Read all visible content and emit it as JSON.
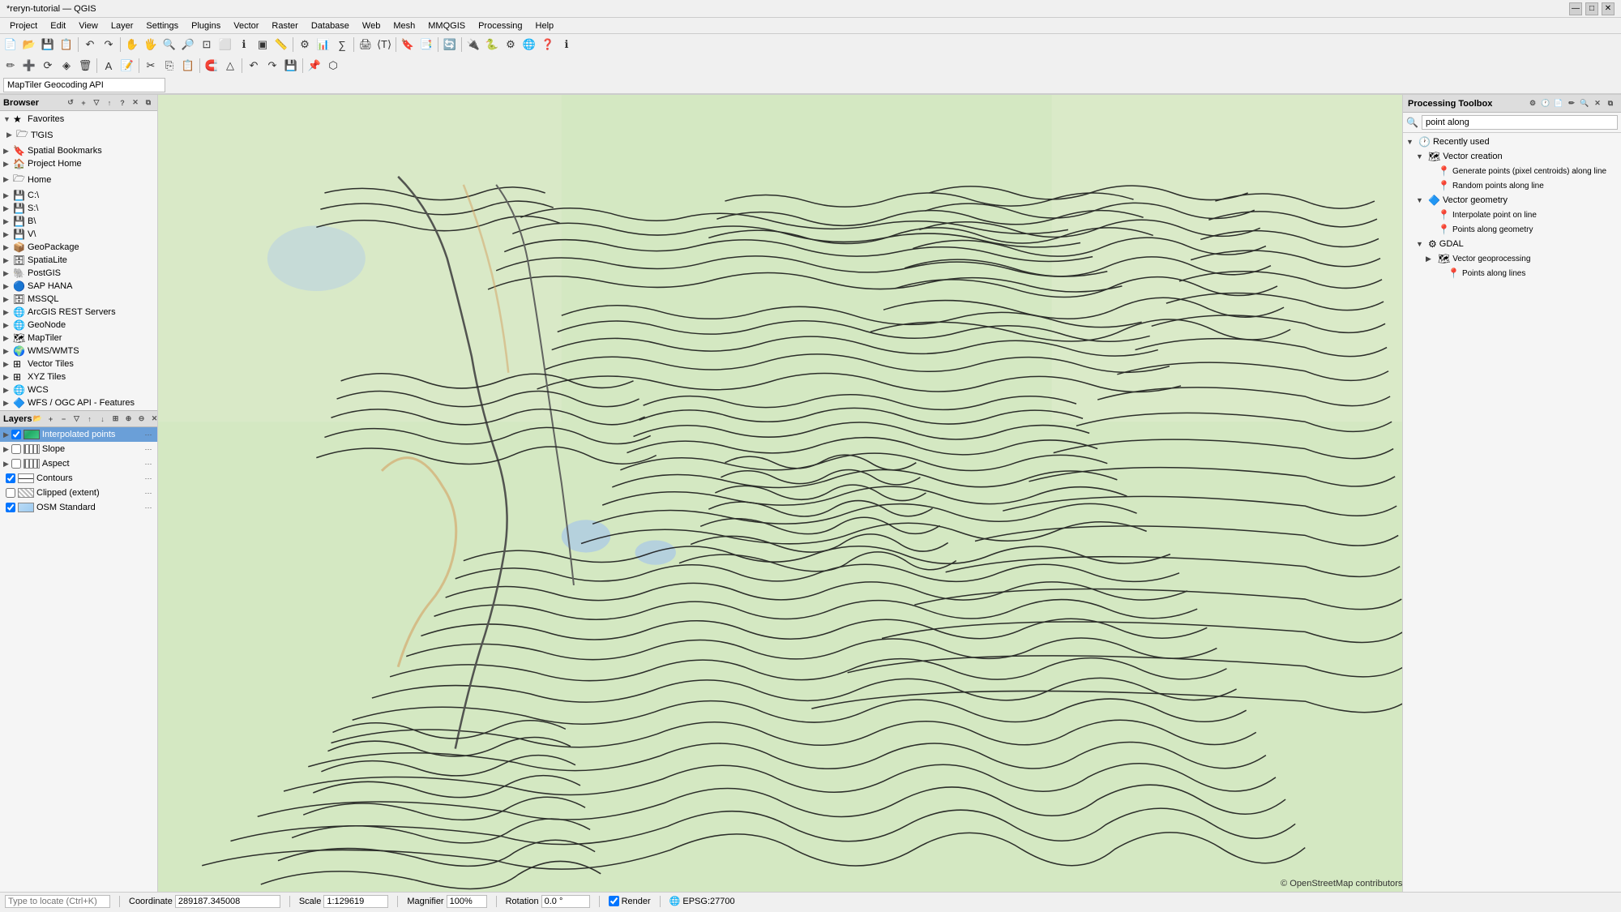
{
  "titlebar": {
    "title": "*reryn-tutorial — QGIS",
    "controls": [
      "—",
      "□",
      "✕"
    ]
  },
  "menubar": {
    "items": [
      "Project",
      "Edit",
      "View",
      "Layer",
      "Settings",
      "Plugins",
      "Vector",
      "Raster",
      "Database",
      "Web",
      "Mesh",
      "MMQGIS",
      "Processing",
      "Help"
    ]
  },
  "geocoding": {
    "placeholder": "MapTiler Geocoding API",
    "value": "MapTiler Geocoding API"
  },
  "browser": {
    "title": "Browser",
    "items": [
      {
        "label": "Favorites",
        "type": "group",
        "expanded": true,
        "level": 0,
        "icon": "★"
      },
      {
        "label": "T▌GIS",
        "type": "item",
        "level": 1,
        "icon": "🗁"
      },
      {
        "label": "Spatial Bookmarks",
        "type": "item",
        "level": 0,
        "icon": "🔖"
      },
      {
        "label": "Project Home",
        "type": "item",
        "level": 0,
        "icon": "🏠"
      },
      {
        "label": "Home",
        "type": "item",
        "level": 0,
        "icon": "🗁"
      },
      {
        "label": "C:\\",
        "type": "item",
        "level": 0,
        "icon": "💾"
      },
      {
        "label": "S:\\",
        "type": "item",
        "level": 0,
        "icon": "💾"
      },
      {
        "label": "B\\",
        "type": "item",
        "level": 0,
        "icon": "💾"
      },
      {
        "label": "V\\",
        "type": "item",
        "level": 0,
        "icon": "💾"
      },
      {
        "label": "GeoPackage",
        "type": "group",
        "level": 0,
        "icon": "📦"
      },
      {
        "label": "SpatiaLite",
        "type": "group",
        "level": 0,
        "icon": "🗄"
      },
      {
        "label": "PostGIS",
        "type": "group",
        "level": 0,
        "icon": "🐘"
      },
      {
        "label": "SAP HANA",
        "type": "group",
        "level": 0,
        "icon": "🔵"
      },
      {
        "label": "MSSQL",
        "type": "group",
        "level": 0,
        "icon": "🗄"
      },
      {
        "label": "ArcGIS REST Servers",
        "type": "group",
        "level": 0,
        "icon": "🌐"
      },
      {
        "label": "GeoNode",
        "type": "group",
        "level": 0,
        "icon": "🌐"
      },
      {
        "label": "MapTiler",
        "type": "group",
        "level": 0,
        "icon": "🗺"
      },
      {
        "label": "WMS/WMTS",
        "type": "group",
        "level": 0,
        "icon": "🌍"
      },
      {
        "label": "Vector Tiles",
        "type": "group",
        "level": 0,
        "icon": "⊞"
      },
      {
        "label": "XYZ Tiles",
        "type": "group",
        "level": 0,
        "icon": "⊞"
      },
      {
        "label": "WCS",
        "type": "group",
        "level": 0,
        "icon": "🌐"
      },
      {
        "label": "WFS / OGC API - Features",
        "type": "group",
        "level": 0,
        "icon": "🔷"
      }
    ]
  },
  "layers": {
    "title": "Layers",
    "items": [
      {
        "label": "Interpolated points",
        "type": "raster",
        "visible": true,
        "selected": true
      },
      {
        "label": "Slope",
        "type": "vector-line",
        "visible": false
      },
      {
        "label": "Aspect",
        "type": "vector-line",
        "visible": false
      },
      {
        "label": "Contours",
        "type": "vector-line",
        "visible": true
      },
      {
        "label": "Clipped (extent)",
        "type": "vector-fill",
        "visible": false
      },
      {
        "label": "OSM Standard",
        "type": "osm",
        "visible": true
      }
    ]
  },
  "processing_toolbox": {
    "title": "Processing Toolbox",
    "search_placeholder": "point along",
    "search_value": "point along",
    "items": [
      {
        "label": "Recently used",
        "level": 0,
        "expanded": true,
        "type": "section"
      },
      {
        "label": "Vector creation",
        "level": 1,
        "expanded": true,
        "type": "section"
      },
      {
        "label": "Generate points (pixel centroids) along line",
        "level": 2,
        "type": "tool"
      },
      {
        "label": "Random points along line",
        "level": 2,
        "type": "tool"
      },
      {
        "label": "Vector geometry",
        "level": 1,
        "expanded": true,
        "type": "section"
      },
      {
        "label": "Interpolate point on line",
        "level": 2,
        "type": "tool"
      },
      {
        "label": "Points along geometry",
        "level": 2,
        "type": "tool"
      },
      {
        "label": "GDAL",
        "level": 1,
        "expanded": true,
        "type": "section"
      },
      {
        "label": "Vector geoprocessing",
        "level": 2,
        "type": "section"
      },
      {
        "label": "Points along lines",
        "level": 3,
        "type": "tool"
      }
    ]
  },
  "statusbar": {
    "locate_placeholder": "Type to locate (Ctrl+K)",
    "coordinate_label": "Coordinate",
    "coordinate_value": "289187.345008",
    "scale_label": "Scale",
    "scale_value": "1:129619",
    "magnifier_label": "Magnifier",
    "magnifier_value": "100%",
    "rotation_label": "Rotation",
    "rotation_value": "0.0 °",
    "render_label": "Render",
    "epsg_label": "EPSG:27700"
  }
}
